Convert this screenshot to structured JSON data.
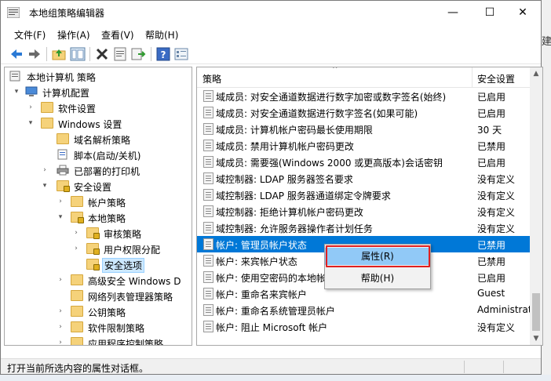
{
  "window": {
    "title": "本地组策略编辑器",
    "minimize": "—",
    "maximize": "☐",
    "close": "✕"
  },
  "menu": [
    "文件(F)",
    "操作(A)",
    "查看(V)",
    "帮助(H)"
  ],
  "toolbar_icons": [
    "back-arrow-icon",
    "forward-arrow-icon",
    "up-folder-icon",
    "show-hide-tree-icon",
    "delete-icon",
    "properties-icon",
    "export-icon",
    "help-icon",
    "view-icon"
  ],
  "tree": {
    "items": [
      {
        "label": "本地计算机 策略"
      },
      {
        "label": "计算机配置"
      },
      {
        "label": "软件设置"
      },
      {
        "label": "Windows 设置"
      },
      {
        "label": "域名解析策略"
      },
      {
        "label": "脚本(启动/关机)"
      },
      {
        "label": "已部署的打印机"
      },
      {
        "label": "安全设置"
      },
      {
        "label": "帐户策略"
      },
      {
        "label": "本地策略"
      },
      {
        "label": "审核策略"
      },
      {
        "label": "用户权限分配"
      },
      {
        "label": "安全选项"
      },
      {
        "label": "高级安全 Windows D"
      },
      {
        "label": "网络列表管理器策略"
      },
      {
        "label": "公钥策略"
      },
      {
        "label": "软件限制策略"
      },
      {
        "label": "应用程序控制策略"
      }
    ]
  },
  "list": {
    "header_policy": "策略",
    "header_setting": "安全设置",
    "rows": [
      {
        "name": "域成员: 对安全通道数据进行数字加密或数字签名(始终)",
        "value": "已启用"
      },
      {
        "name": "域成员: 对安全通道数据进行数字签名(如果可能)",
        "value": "已启用"
      },
      {
        "name": "域成员: 计算机帐户密码最长使用期限",
        "value": "30 天"
      },
      {
        "name": "域成员: 禁用计算机帐户密码更改",
        "value": "已禁用"
      },
      {
        "name": "域成员: 需要强(Windows 2000 或更高版本)会话密钥",
        "value": "已启用"
      },
      {
        "name": "域控制器: LDAP 服务器签名要求",
        "value": "没有定义"
      },
      {
        "name": "域控制器: LDAP 服务器通道绑定令牌要求",
        "value": "没有定义"
      },
      {
        "name": "域控制器: 拒绝计算机帐户密码更改",
        "value": "没有定义"
      },
      {
        "name": "域控制器: 允许服务器操作者计划任务",
        "value": "没有定义"
      },
      {
        "name": "帐户: 管理员帐户状态",
        "value": "已禁用"
      },
      {
        "name": "帐户: 来宾帐户状态",
        "value": "已禁用"
      },
      {
        "name": "帐户: 使用空密码的本地帐户",
        "value": "已启用"
      },
      {
        "name": "帐户: 重命名来宾帐户",
        "value": "Guest"
      },
      {
        "name": "帐户: 重命名系统管理员帐户",
        "value": "Administrat"
      },
      {
        "name": "帐户: 阻止 Microsoft 帐户",
        "value": "没有定义"
      }
    ]
  },
  "context_menu": {
    "properties": "属性(R)",
    "help": "帮助(H)"
  },
  "status": "打开当前所选内容的属性对话框。",
  "background_peek": "建"
}
